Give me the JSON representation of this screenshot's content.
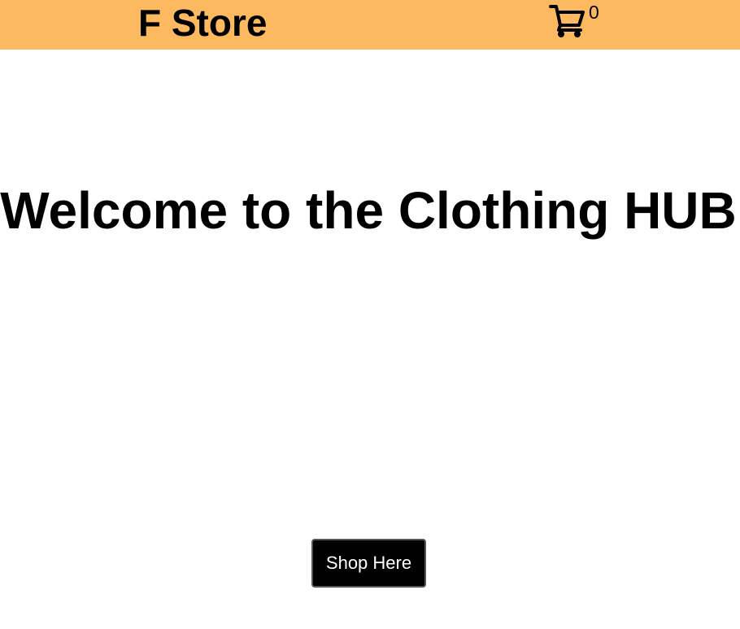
{
  "header": {
    "brand": "F Store",
    "cart_icon": "shopping-cart-icon",
    "cart_count": "0",
    "background_color": "#fdb960"
  },
  "hero": {
    "title": "Welcome to the Clothing HUB",
    "cta_label": "Shop Here",
    "cta_background": "#000000",
    "cta_text_color": "#ffffff"
  }
}
